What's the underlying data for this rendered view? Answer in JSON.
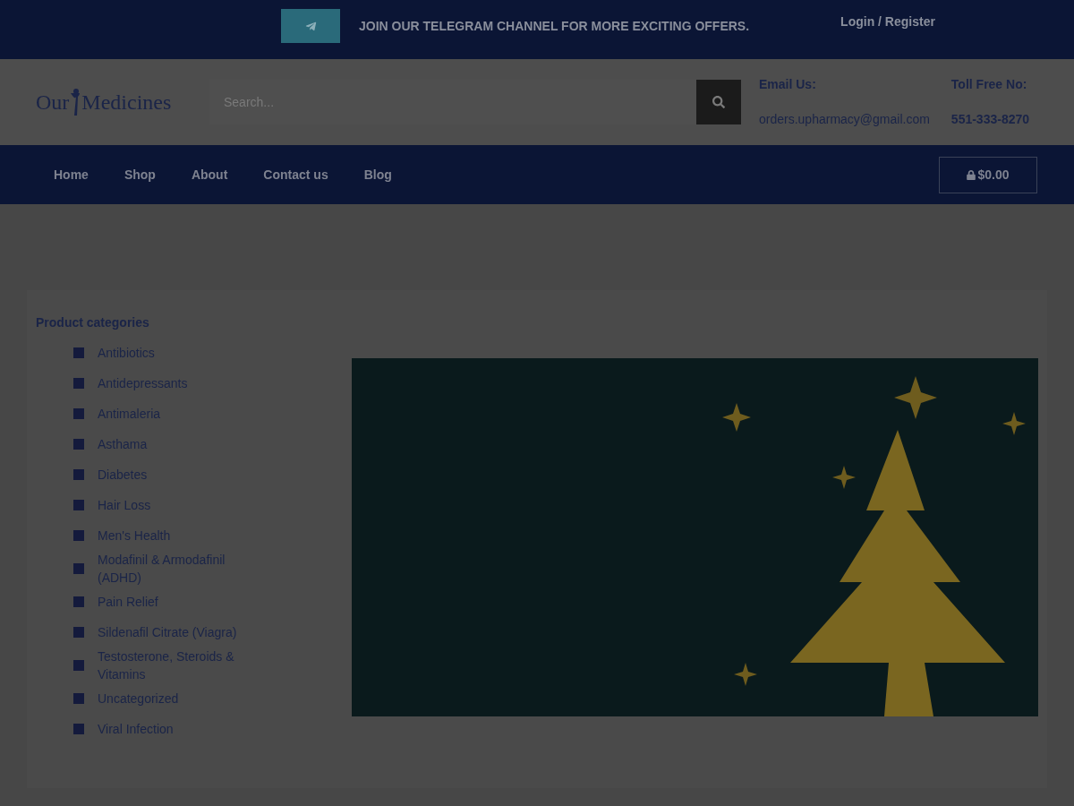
{
  "top_bar": {
    "promo": "JOIN OUR TELEGRAM CHANNEL FOR MORE EXCITING OFFERS.",
    "account_link": "Login / Register"
  },
  "header": {
    "logo": {
      "left": "Our",
      "right": "Medicines"
    },
    "search": {
      "placeholder": "Search..."
    },
    "contacts": [
      {
        "label": "Email Us:",
        "value": "orders.upharmacy@gmail.com",
        "bold_value": false
      },
      {
        "label": "Toll Free No:",
        "value": "551-333-8270",
        "bold_value": true
      }
    ]
  },
  "nav": {
    "items": [
      "Home",
      "Shop",
      "About",
      "Contact us",
      "Blog"
    ],
    "cart_total": "$0.00"
  },
  "sidebar": {
    "title": "Product categories",
    "categories": [
      "Antibiotics",
      "Antidepressants",
      "Antimaleria",
      "Asthama",
      "Diabetes",
      "Hair Loss",
      "Men's Health",
      "Modafinil & Armodafinil (ADHD)",
      "Pain Relief",
      "Sildenafil Citrate (Viagra)",
      "Testosterone, Steroids & Vitamins",
      "Uncategorized",
      "Viral Infection"
    ]
  }
}
